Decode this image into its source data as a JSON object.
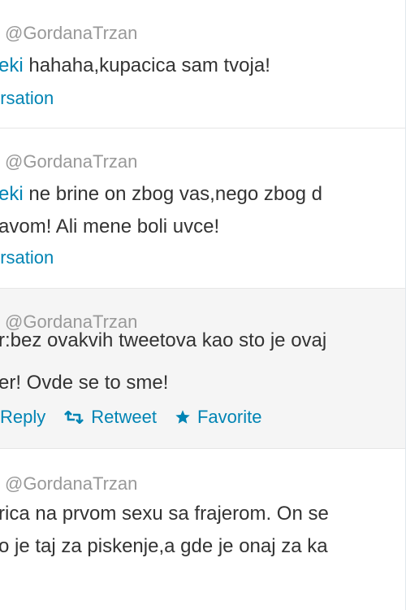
{
  "tweets": [
    {
      "handle": "@GordanaTrzan",
      "mention": "eki",
      "line1": " hahaha,kupacica sam tvoja!",
      "line2": "",
      "conversation": "ersation"
    },
    {
      "handle": "@GordanaTrzan",
      "mention": "eki",
      "line1": " ne brine on zbog vas,nego zbog d",
      "line2": "avom! Ali mene boli uvce!",
      "conversation": "ersation"
    },
    {
      "handle": "@GordanaTrzan",
      "line1": "r:bez ovakvih tweetova kao sto je ovaj",
      "line2": "er! Ovde se to sme!",
      "actions": {
        "reply": "Reply",
        "retweet": "Retweet",
        "favorite": "Favorite"
      }
    },
    {
      "handle": "@GordanaTrzan",
      "line1": "rica na prvom sexu sa frajerom. On se",
      "line2": "o je taj za piskenje,a gde je onaj za ka"
    }
  ],
  "colors": {
    "link": "#0084b4",
    "muted": "#999999",
    "text": "#333333",
    "hover_bg": "#f5f5f5"
  },
  "icons": {
    "retweet": "retweet-icon",
    "favorite": "star-icon"
  }
}
